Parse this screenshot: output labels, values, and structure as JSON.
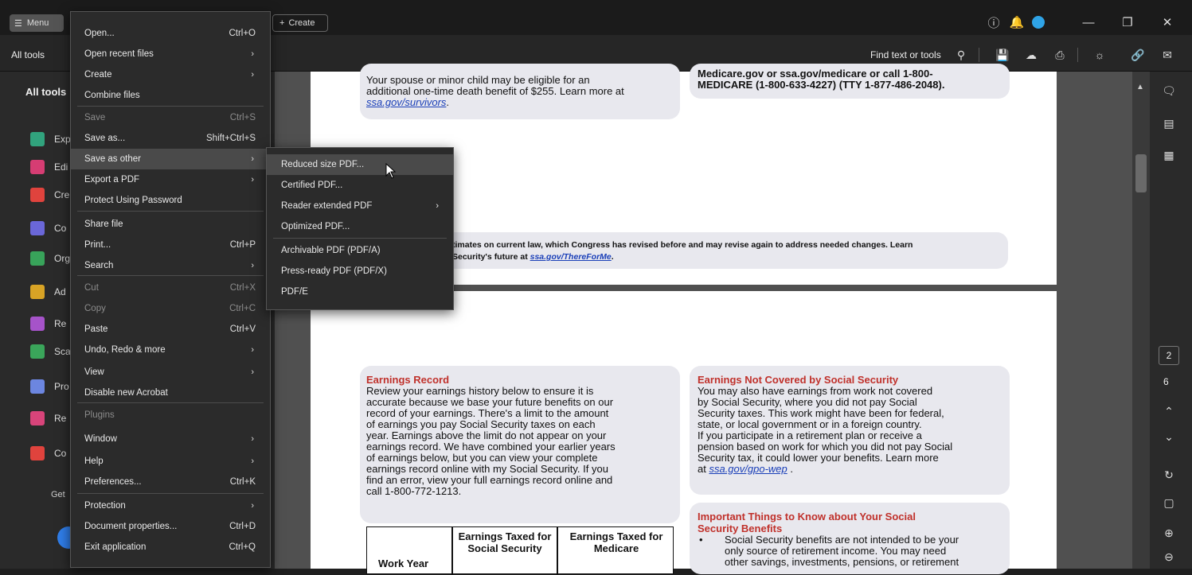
{
  "titlebar": {
    "menu_label": "Menu",
    "create_label": "Create",
    "icons": [
      "help-icon",
      "bell-icon",
      "profile-avatar",
      "minimize-icon",
      "restore-icon",
      "close-icon"
    ]
  },
  "toolbar": {
    "all_tools_tab": "All tools",
    "find_label": "Find text or tools",
    "icons": [
      "search-icon",
      "save-icon",
      "upload-cloud-icon",
      "print-icon",
      "ai-assistant-icon",
      "link-icon",
      "mail-icon"
    ]
  },
  "left_panel": {
    "title": "All tools",
    "items": [
      {
        "icon": "export-pdf-icon",
        "label": "Exp",
        "color": "#31a37d"
      },
      {
        "icon": "edit-pdf-icon",
        "label": "Edi",
        "color": "#d63d73"
      },
      {
        "icon": "create-pdf-icon",
        "label": "Cre",
        "color": "#e0433d"
      },
      {
        "icon": "combine-icon",
        "label": "Co",
        "color": "#6a67d8"
      },
      {
        "icon": "organize-icon",
        "label": "Org",
        "color": "#38a35a"
      },
      {
        "icon": "comment-icon",
        "label": "Ad",
        "color": "#d8a325"
      },
      {
        "icon": "redact-icon",
        "label": "Re",
        "color": "#a653c9"
      },
      {
        "icon": "scan-icon",
        "label": "Sca",
        "color": "#3aa55a"
      },
      {
        "icon": "protect-icon",
        "label": "Pro",
        "color": "#6c86e0"
      },
      {
        "icon": "request-sign-icon",
        "label": "Re",
        "color": "#d8447a"
      },
      {
        "icon": "compress-icon",
        "label": "Co",
        "color": "#e0433d"
      }
    ],
    "get_label": "Get"
  },
  "main_menu": {
    "items": [
      {
        "label": "Open...",
        "shortcut": "Ctrl+O"
      },
      {
        "label": "Open recent files",
        "arrow": "›"
      },
      {
        "label": "Create",
        "arrow": "›"
      },
      {
        "label": "Combine files"
      },
      {
        "label": "Save",
        "shortcut": "Ctrl+S",
        "dim": true
      },
      {
        "label": "Save as...",
        "shortcut": "Shift+Ctrl+S"
      },
      {
        "label": "Save as other",
        "arrow": "›",
        "highlighted": true
      },
      {
        "label": "Export a PDF",
        "arrow": "›"
      },
      {
        "label": "Protect Using Password"
      },
      {
        "label": "Share file"
      },
      {
        "label": "Print...",
        "shortcut": "Ctrl+P"
      },
      {
        "label": "Search",
        "arrow": "›"
      },
      {
        "label": "Cut",
        "shortcut": "Ctrl+X",
        "dim": true
      },
      {
        "label": "Copy",
        "shortcut": "Ctrl+C",
        "dim": true
      },
      {
        "label": "Paste",
        "shortcut": "Ctrl+V"
      },
      {
        "label": "Undo, Redo & more",
        "arrow": "›"
      },
      {
        "label": "View",
        "arrow": "›"
      },
      {
        "label": "Disable new Acrobat"
      },
      {
        "label": "Plugins",
        "dim": true
      },
      {
        "label": "Window",
        "arrow": "›"
      },
      {
        "label": "Help",
        "arrow": "›"
      },
      {
        "label": "Preferences...",
        "shortcut": "Ctrl+K"
      },
      {
        "label": "Protection",
        "arrow": "›"
      },
      {
        "label": "Document properties...",
        "shortcut": "Ctrl+D"
      },
      {
        "label": "Exit application",
        "shortcut": "Ctrl+Q"
      }
    ]
  },
  "sub_menu": {
    "items": [
      {
        "label": "Reduced size PDF...",
        "highlighted": true
      },
      {
        "label": "Certified PDF..."
      },
      {
        "label": "Reader extended PDF",
        "arrow": "›"
      },
      {
        "label": "Optimized PDF..."
      },
      {
        "label": "Archivable PDF (PDF/A)"
      },
      {
        "label": "Press-ready PDF (PDF/X)"
      },
      {
        "label": "PDF/E"
      }
    ]
  },
  "document": {
    "survivors_text_1": "Your spouse or minor child may be eligible for an",
    "survivors_text_2": "additional one-time death benefit of $255. Learn more at",
    "survivors_link": "ssa.gov/survivors",
    "survivors_link_suffix": ".",
    "medicare_line_1": "Medicare.gov or ssa.gov/medicare or call 1-800-",
    "medicare_line_2": "MEDICARE (1-800-633-4227) (TTY 1-877-486-2048).",
    "estimates_line_1": "timates on current law, which Congress has revised before and may revise again to address needed changes.  Learn",
    "estimates_line_2": "Security's future at",
    "estimates_link": "ssa.gov/ThereForMe",
    "earnings_title": "Earnings Record",
    "earnings_lines": [
      "Review your earnings history below to ensure it is",
      "accurate because we base your future benefits on our",
      "record of your earnings. There's a limit to the amount",
      "of earnings you pay Social Security taxes on each",
      "year. Earnings above the limit do not appear on your",
      "earnings record. We have combined your earlier years",
      "of earnings below, but you can view your complete",
      "earnings record online with my Social Security. If you",
      "find an error, view your full earnings record online and",
      "call 1-800-772-1213."
    ],
    "not_covered_title": "Earnings Not Covered by Social Security",
    "not_covered_lines": [
      "You may also have earnings from work not covered",
      "by Social Security, where you did not pay Social",
      "Security taxes. This work might have been for federal,",
      "state, or local government or in a foreign country.",
      "If you participate in a retirement plan or receive a",
      "pension based on work for which you did not pay Social",
      "Security tax, it could lower your benefits. Learn more"
    ],
    "not_covered_link_prefix": "at",
    "not_covered_link": "ssa.gov/gpo-wep",
    "not_covered_link_suffix": ".",
    "important_title_1": "Important Things to Know about Your Social",
    "important_title_2": "Security Benefits",
    "important_bullet": "•",
    "important_lines": [
      "Social Security benefits are not intended to be your",
      "only source of retirement income. You may need",
      "other savings, investments, pensions, or retirement"
    ],
    "table_headers": [
      "Work Year",
      "Earnings Taxed for Social Security",
      "Earnings Taxed for Medicare"
    ]
  },
  "right_rail": {
    "icons": [
      "comment-icon",
      "bookmark-icon",
      "thumbnails-icon",
      "chevron-up-icon",
      "chevron-down-icon",
      "refresh-icon",
      "page-fit-icon",
      "zoom-in-icon",
      "zoom-out-icon"
    ],
    "current_page": "2",
    "total_pages": "6"
  }
}
